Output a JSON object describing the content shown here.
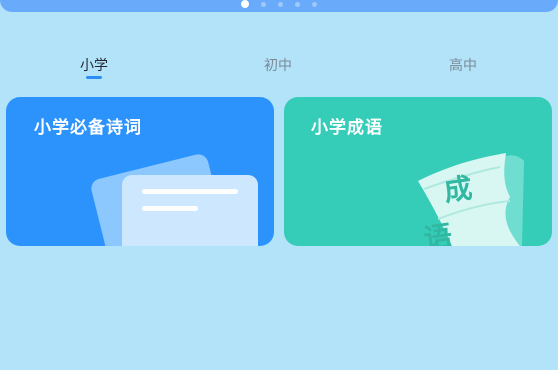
{
  "banner": {
    "page_count": 5,
    "active_index": 0
  },
  "tabs": [
    {
      "label": "小学",
      "active": true
    },
    {
      "label": "初中",
      "active": false
    },
    {
      "label": "高中",
      "active": false
    }
  ],
  "cards": {
    "poems": {
      "title": "小学必备诗词",
      "icon": "document-icon",
      "color": "#2d93fc"
    },
    "idioms": {
      "title": "小学成语",
      "icon": "idiom-scroll-icon",
      "color": "#35cdb8",
      "icon_text_1": "成",
      "icon_text_2": "语"
    }
  }
}
